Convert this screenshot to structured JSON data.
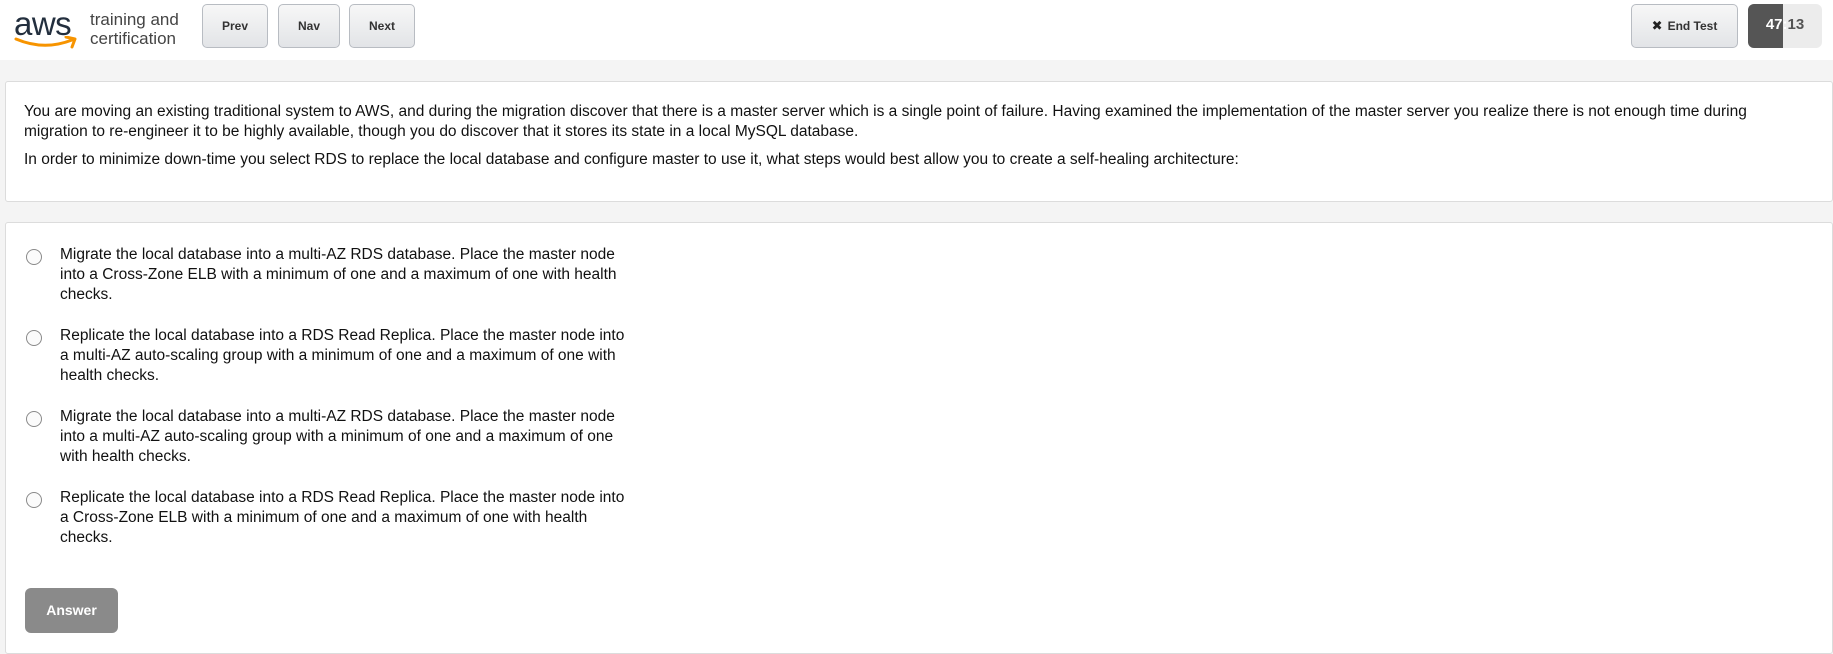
{
  "header": {
    "logo": {
      "wordmark": "aws",
      "line1": "training and",
      "line2": "certification",
      "accent_color": "#f79400"
    },
    "nav_buttons": {
      "prev_label": "Prev",
      "nav_label": "Nav",
      "next_label": "Next"
    },
    "end_test": {
      "icon": "close-icon",
      "label": "End Test"
    },
    "timer": {
      "minutes": "47",
      "separator": ":",
      "seconds": "13",
      "progress_fraction": 0.47,
      "fill_color": "#555555"
    }
  },
  "question": {
    "paragraph1": "You are moving an existing traditional system to AWS, and during the migration discover that there is a master server which is a single point of failure. Having examined the implementation of the master server you realize there is not enough time during migration to re-engineer it to be highly available, though you do discover that it stores its state in a local MySQL database.",
    "paragraph2": "In order to minimize down-time you select RDS to replace the local database and configure master to use it, what steps would best allow you to create a self-healing architecture:"
  },
  "options": [
    {
      "text": "Migrate the local database into a multi-AZ RDS database. Place the master node into a Cross-Zone ELB with a minimum of one and a maximum of one with health checks."
    },
    {
      "text": "Replicate the local database into a RDS Read Replica. Place the master node into a multi-AZ auto-scaling group with a minimum of one and a maximum of one with health checks."
    },
    {
      "text": "Migrate the local database into a multi-AZ RDS database. Place the master node into a multi-AZ auto-scaling group with a minimum of one and a maximum of one with health checks."
    },
    {
      "text": "Replicate the local database into a RDS Read Replica. Place the master node into a Cross-Zone ELB with a minimum of one and a maximum of one with health checks."
    }
  ],
  "answer_button": {
    "label": "Answer",
    "color": "#8a8a8a"
  }
}
